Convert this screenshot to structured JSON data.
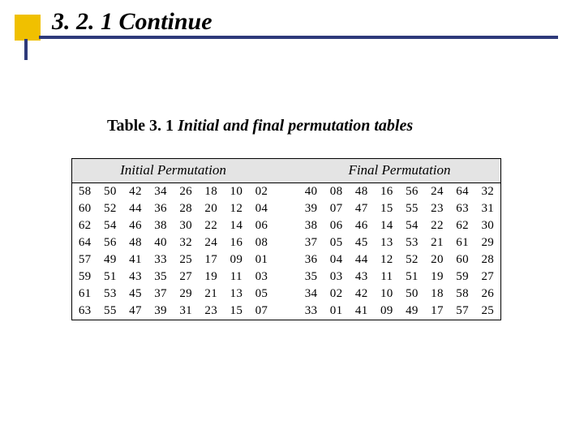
{
  "heading": "3. 2. 1  Continue",
  "caption_lead": "Table 3. 1",
  "caption_rest": "  Initial and final permutation tables",
  "table": {
    "header_left": "Initial Permutation",
    "header_right": "Final Permutation",
    "initial": [
      [
        "58",
        "50",
        "42",
        "34",
        "26",
        "18",
        "10",
        "02"
      ],
      [
        "60",
        "52",
        "44",
        "36",
        "28",
        "20",
        "12",
        "04"
      ],
      [
        "62",
        "54",
        "46",
        "38",
        "30",
        "22",
        "14",
        "06"
      ],
      [
        "64",
        "56",
        "48",
        "40",
        "32",
        "24",
        "16",
        "08"
      ],
      [
        "57",
        "49",
        "41",
        "33",
        "25",
        "17",
        "09",
        "01"
      ],
      [
        "59",
        "51",
        "43",
        "35",
        "27",
        "19",
        "11",
        "03"
      ],
      [
        "61",
        "53",
        "45",
        "37",
        "29",
        "21",
        "13",
        "05"
      ],
      [
        "63",
        "55",
        "47",
        "39",
        "31",
        "23",
        "15",
        "07"
      ]
    ],
    "final": [
      [
        "40",
        "08",
        "48",
        "16",
        "56",
        "24",
        "64",
        "32"
      ],
      [
        "39",
        "07",
        "47",
        "15",
        "55",
        "23",
        "63",
        "31"
      ],
      [
        "38",
        "06",
        "46",
        "14",
        "54",
        "22",
        "62",
        "30"
      ],
      [
        "37",
        "05",
        "45",
        "13",
        "53",
        "21",
        "61",
        "29"
      ],
      [
        "36",
        "04",
        "44",
        "12",
        "52",
        "20",
        "60",
        "28"
      ],
      [
        "35",
        "03",
        "43",
        "11",
        "51",
        "19",
        "59",
        "27"
      ],
      [
        "34",
        "02",
        "42",
        "10",
        "50",
        "18",
        "58",
        "26"
      ],
      [
        "33",
        "01",
        "41",
        "09",
        "49",
        "17",
        "57",
        "25"
      ]
    ]
  }
}
